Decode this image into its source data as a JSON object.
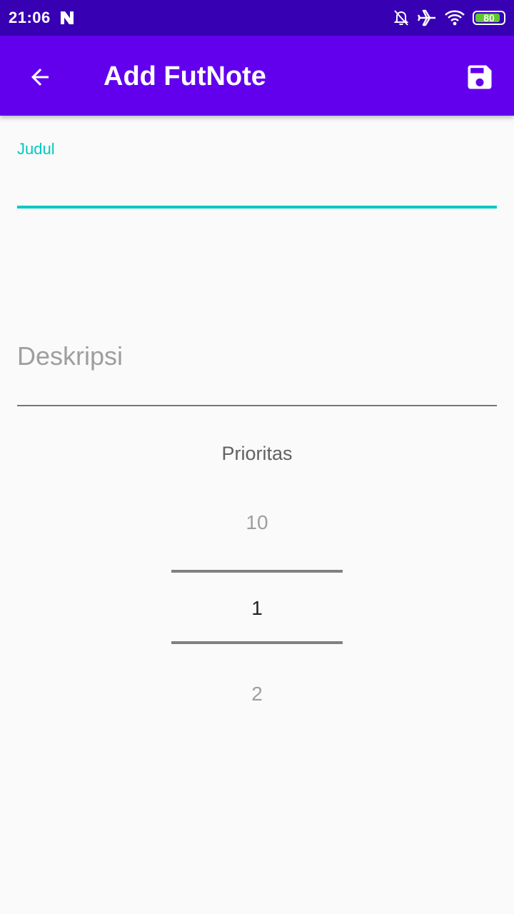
{
  "status_bar": {
    "time": "21:06",
    "notification_icon": "n-icon",
    "icons": [
      "bell-off-icon",
      "airplane-icon",
      "wifi-icon",
      "battery-icon"
    ],
    "battery_level": "80",
    "battery_color": "#5ec833"
  },
  "app_bar": {
    "title": "Add FutNote",
    "back_icon": "arrow-back-icon",
    "save_icon": "save-icon",
    "color": "#6200ee",
    "status_color": "#3700b3"
  },
  "form": {
    "judul": {
      "label": "Judul",
      "value": "",
      "accent_color": "#03c9c0"
    },
    "deskripsi": {
      "placeholder": "Deskripsi",
      "value": ""
    },
    "prioritas": {
      "label": "Prioritas",
      "prev_value": "10",
      "selected_value": "1",
      "next_value": "2"
    }
  }
}
